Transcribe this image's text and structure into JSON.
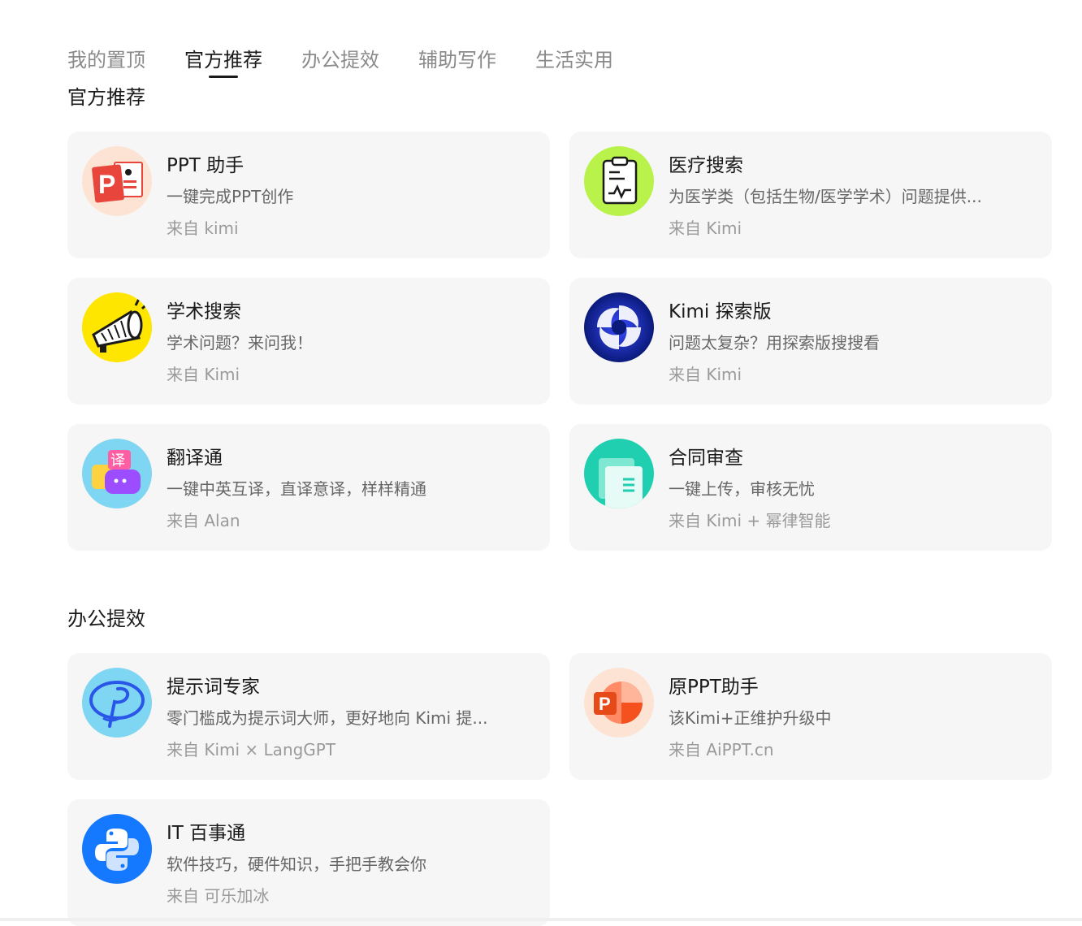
{
  "tabs": [
    {
      "label": "我的置顶",
      "active": false
    },
    {
      "label": "官方推荐",
      "active": true
    },
    {
      "label": "办公提效",
      "active": false
    },
    {
      "label": "辅助写作",
      "active": false
    },
    {
      "label": "生活实用",
      "active": false
    }
  ],
  "sections": [
    {
      "title": "官方推荐",
      "cards": [
        {
          "name": "PPT 助手",
          "desc": "一键完成PPT创作",
          "source": "来自 kimi",
          "icon": "ppt-assistant-icon"
        },
        {
          "name": "医疗搜索",
          "desc": "为医学类（包括生物/医学学术）问题提供...",
          "source": "来自 Kimi",
          "icon": "medical-clipboard-icon"
        },
        {
          "name": "学术搜索",
          "desc": "学术问题？来问我！",
          "source": "来自 Kimi",
          "icon": "megaphone-icon"
        },
        {
          "name": "Kimi 探索版",
          "desc": "问题太复杂？用探索版搜搜看",
          "source": "来自 Kimi",
          "icon": "swirl-icon"
        },
        {
          "name": "翻译通",
          "desc": "一键中英互译，直译意译，样样精通",
          "source": "来自 Alan",
          "icon": "translate-chat-icon"
        },
        {
          "name": "合同审查",
          "desc": "一键上传，审核无忧",
          "source": "来自 Kimi + 幂律智能",
          "icon": "contract-document-icon"
        }
      ]
    },
    {
      "title": "办公提效",
      "cards": [
        {
          "name": "提示词专家",
          "desc": "零门槛成为提示词大师，更好地向 Kimi 提...",
          "source": "来自 Kimi × LangGPT",
          "icon": "prompt-p-icon"
        },
        {
          "name": "原PPT助手",
          "desc": "该Kimi+正维护升级中",
          "source": "来自 AiPPT.cn",
          "icon": "powerpoint-icon"
        },
        {
          "name": "IT 百事通",
          "desc": "软件技巧，硬件知识，手把手教会你",
          "source": "来自 可乐加冰",
          "icon": "python-logo-icon"
        }
      ]
    }
  ],
  "icon_letters": {
    "ppt": "P",
    "translate": "译",
    "powerpoint": "P"
  }
}
